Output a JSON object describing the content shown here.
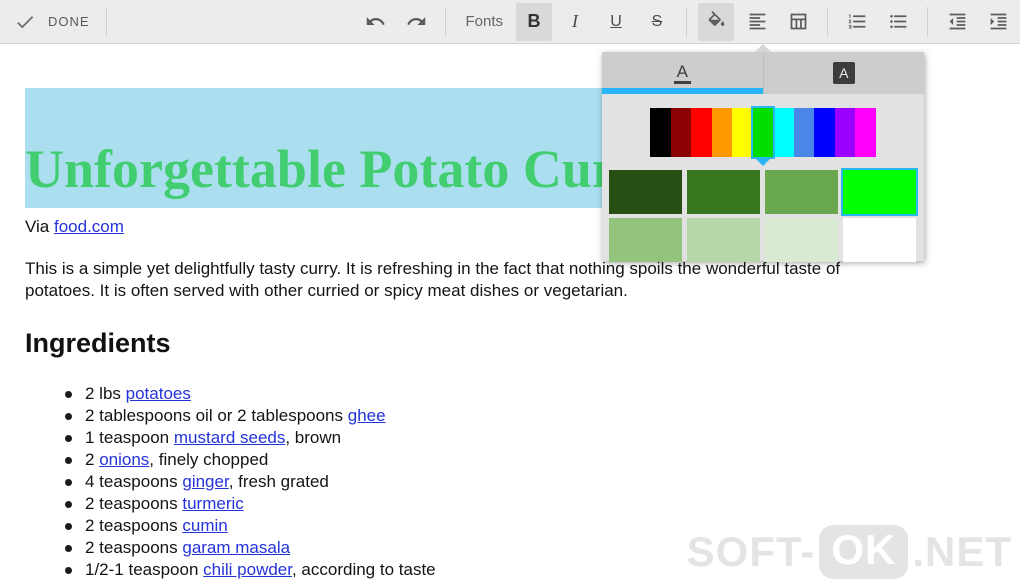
{
  "toolbar": {
    "done_label": "DONE",
    "fonts_label": "Fonts",
    "bold_label": "B",
    "italic_label": "I",
    "underline_label": "U",
    "strikethrough_label": "S"
  },
  "color_picker": {
    "accent_color": "#29b6f6",
    "tabs": [
      {
        "label": "A",
        "name": "text-color"
      },
      {
        "label": "A",
        "name": "highlight-color"
      }
    ],
    "spectrum": [
      "#000000",
      "#8b0000",
      "#ff0000",
      "#ff9900",
      "#ffff00",
      "#00dd00",
      "#00ffff",
      "#4a86e8",
      "#0000ff",
      "#9900ff",
      "#ff00ff"
    ],
    "spectrum_selected_index": 5,
    "palette": [
      [
        "#274e13",
        "#38761d",
        "#6aa84f",
        "#00ff00"
      ],
      [
        "#93c47d",
        "#b6d7a8",
        "#d9ead3",
        "#ffffff"
      ]
    ],
    "palette_selected_flat_index": 3
  },
  "document": {
    "title": {
      "text": "Unforgettable Potato Curry",
      "color": "#41cd70",
      "highlight_color": "#abdff0"
    },
    "byline_prefix": "Via ",
    "byline_link": "food.com",
    "link_color": "#2433d9",
    "intro_line1": "This is a simple yet delightfully tasty curry. It is refreshing in the fact that nothing spoils the wonderful taste of",
    "intro_line2": "potatoes. It is often served with other curried or spicy meat dishes or vegetarian.",
    "ingredients_heading": "Ingredients",
    "ingredients": [
      {
        "pre": "2 lbs ",
        "link": "potatoes",
        "post": ""
      },
      {
        "pre": "2 tablespoons oil or 2 tablespoons ",
        "link": "ghee",
        "post": ""
      },
      {
        "pre": "1 teaspoon ",
        "link": "mustard seeds",
        "post": ", brown"
      },
      {
        "pre": "2 ",
        "link": "onions",
        "post": ", finely chopped"
      },
      {
        "pre": "4 teaspoons ",
        "link": "ginger",
        "post": ", fresh grated"
      },
      {
        "pre": "2 teaspoons ",
        "link": "turmeric",
        "post": ""
      },
      {
        "pre": "2 teaspoons ",
        "link": "cumin",
        "post": ""
      },
      {
        "pre": "2 teaspoons ",
        "link": "garam masala",
        "post": ""
      },
      {
        "pre": "1/2-1 teaspoon ",
        "link": "chili powder",
        "post": ", according to taste"
      }
    ]
  },
  "watermark": {
    "part1": "SOFT-",
    "badge": "OK",
    "part2": ".NET"
  }
}
